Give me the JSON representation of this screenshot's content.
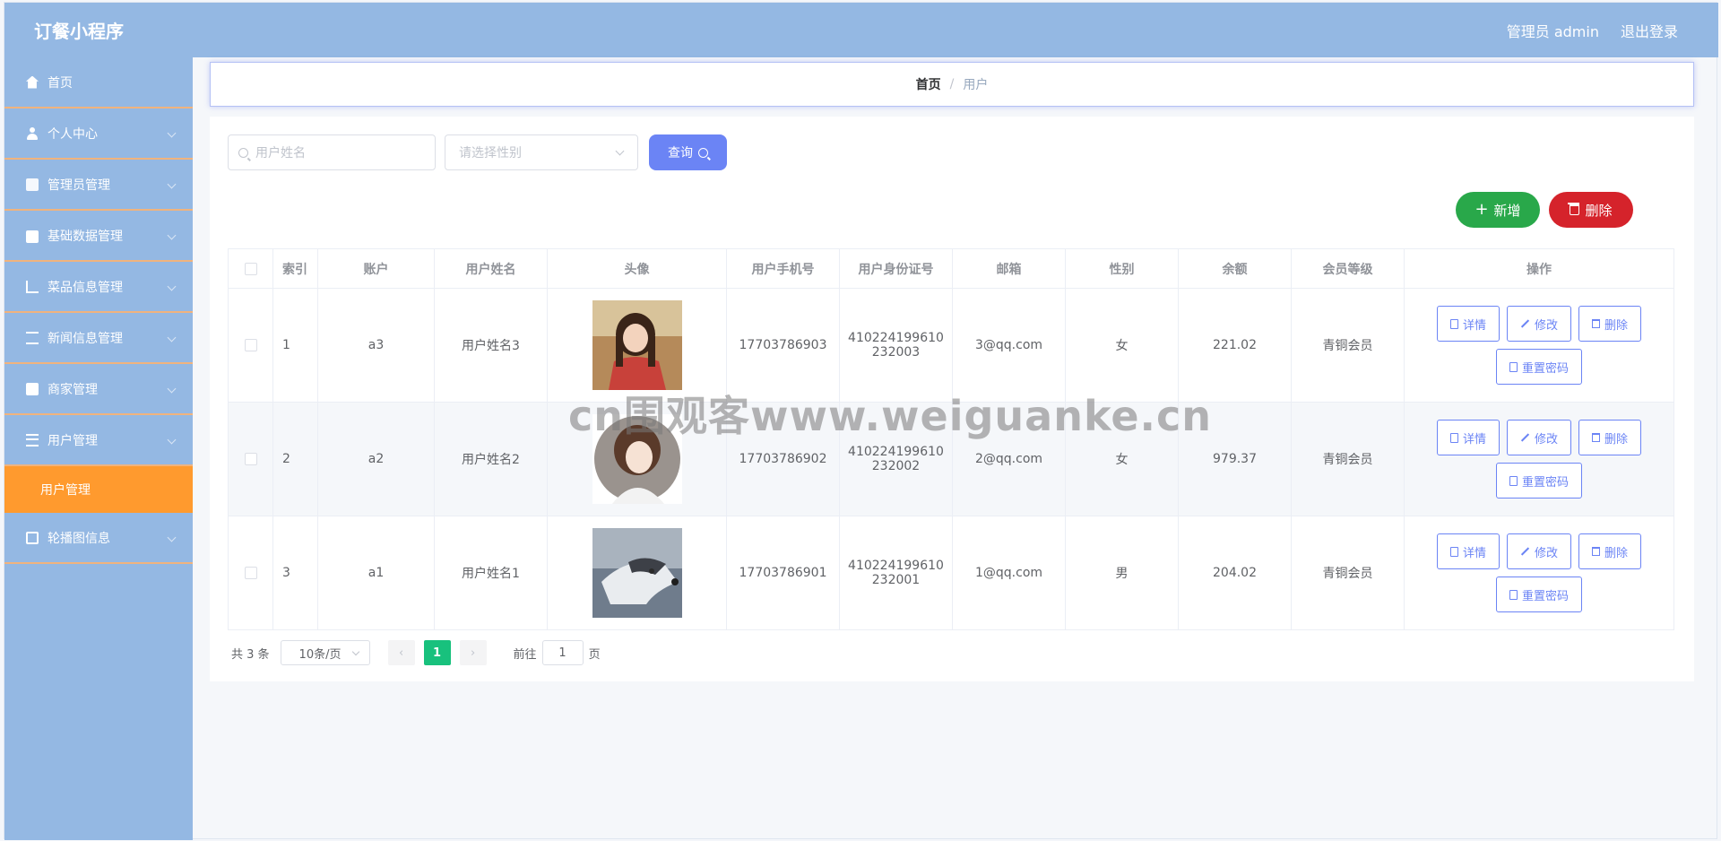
{
  "header": {
    "title": "订餐小程序",
    "admin_label": "管理员 admin",
    "logout_label": "退出登录"
  },
  "sidebar": {
    "items": [
      {
        "label": "首页",
        "icon": "home-icon"
      },
      {
        "label": "个人中心",
        "icon": "user-icon"
      },
      {
        "label": "管理员管理",
        "icon": "chart-icon"
      },
      {
        "label": "基础数据管理",
        "icon": "briefcase-icon"
      },
      {
        "label": "菜品信息管理",
        "icon": "crop-icon"
      },
      {
        "label": "新闻信息管理",
        "icon": "sliders-icon"
      },
      {
        "label": "商家管理",
        "icon": "chat-icon"
      },
      {
        "label": "用户管理",
        "icon": "list-icon"
      },
      {
        "label": "轮播图信息",
        "icon": "image-icon"
      }
    ],
    "active_submenu": "用户管理"
  },
  "breadcrumb": {
    "home": "首页",
    "separator": "/",
    "current": "用户"
  },
  "search": {
    "name_placeholder": "用户姓名",
    "gender_placeholder": "请选择性别",
    "query_label": "查询"
  },
  "actions": {
    "add_label": "新增",
    "delete_label": "删除"
  },
  "table": {
    "columns": [
      "索引",
      "账户",
      "用户姓名",
      "头像",
      "用户手机号",
      "用户身份证号",
      "邮箱",
      "性别",
      "余额",
      "会员等级",
      "操作"
    ],
    "rows": [
      {
        "index": "1",
        "account": "a3",
        "name": "用户姓名3",
        "phone": "17703786903",
        "id_line1": "410224199610",
        "id_line2": "232003",
        "email": "3@qq.com",
        "gender": "女",
        "balance": "221.02",
        "level": "青铜会员"
      },
      {
        "index": "2",
        "account": "a2",
        "name": "用户姓名2",
        "phone": "17703786902",
        "id_line1": "410224199610",
        "id_line2": "232002",
        "email": "2@qq.com",
        "gender": "女",
        "balance": "979.37",
        "level": "青铜会员"
      },
      {
        "index": "3",
        "account": "a1",
        "name": "用户姓名1",
        "phone": "17703786901",
        "id_line1": "410224199610",
        "id_line2": "232001",
        "email": "1@qq.com",
        "gender": "男",
        "balance": "204.02",
        "level": "青铜会员"
      }
    ],
    "op_labels": {
      "detail": "详情",
      "edit": "修改",
      "delete": "删除",
      "reset": "重置密码"
    }
  },
  "pagination": {
    "total": "共 3 条",
    "page_size": "10条/页",
    "prev": "‹",
    "current_page": "1",
    "next": "›",
    "goto_label": "前往",
    "goto_value": "1",
    "page_unit": "页"
  },
  "watermark": "cn围观客www.weiguanke.cn",
  "colors": {
    "header_bg": "#94b8e3",
    "sidebar_active": "#ff9a2e",
    "primary": "#6b84f5",
    "success": "#29a84a",
    "danger": "#d5232b",
    "page_active": "#18c17d"
  }
}
